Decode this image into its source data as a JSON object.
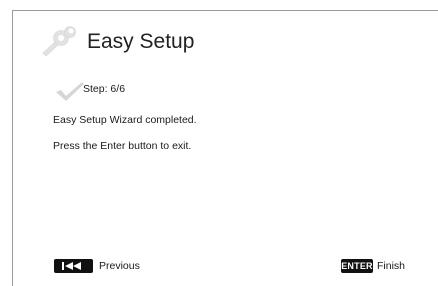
{
  "header": {
    "title": "Easy Setup",
    "icon": "wrench-icon"
  },
  "step": {
    "label": "Step: 6/6",
    "icon": "checkmark-icon"
  },
  "messages": {
    "line1": "Easy Setup Wizard completed.",
    "line2": "Press the Enter button to exit."
  },
  "footer": {
    "previous": {
      "key_icon": "skip-back-icon",
      "label": "Previous"
    },
    "finish": {
      "key_label": "ENTER",
      "label": "Finish"
    }
  }
}
